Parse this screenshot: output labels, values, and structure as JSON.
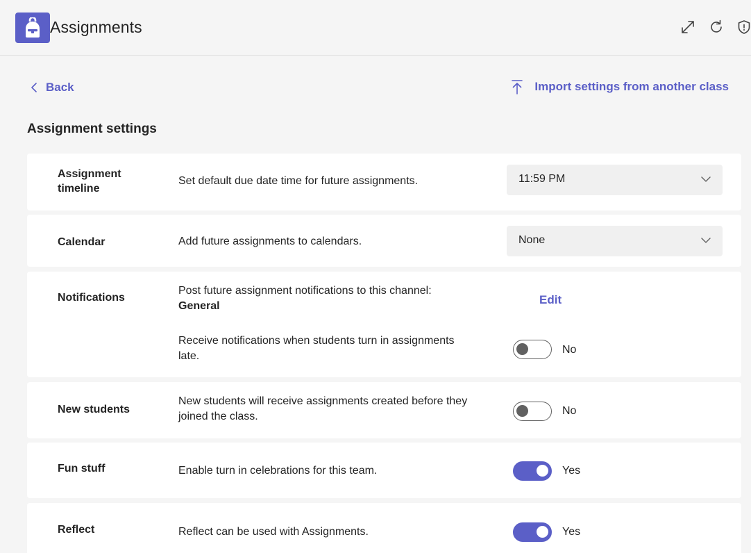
{
  "app": {
    "title": "Assignments",
    "icons": [
      "backpack-icon",
      "expand-icon",
      "refresh-icon",
      "shield-icon"
    ],
    "accent_color": "#5b5fc7"
  },
  "nav": {
    "back_label": "Back",
    "import_label": "Import settings from another class"
  },
  "section_title": "Assignment settings",
  "settings": {
    "timeline": {
      "label": "Assignment timeline",
      "description": "Set default due date time for future assignments.",
      "value": "11:59 PM"
    },
    "calendar": {
      "label": "Calendar",
      "description": "Add future assignments to calendars.",
      "value": "None"
    },
    "notifications": {
      "label": "Notifications",
      "channel_description": "Post future assignment notifications to this channel:",
      "channel_name": "General",
      "edit_label": "Edit",
      "late_description": "Receive notifications when students turn in assignments late.",
      "late_state": "No",
      "late_on": false
    },
    "new_students": {
      "label": "New students",
      "description": "New students will receive assignments created before they joined the class.",
      "state": "No",
      "on": false
    },
    "fun_stuff": {
      "label": "Fun stuff",
      "description": "Enable turn in celebrations for this team.",
      "state": "Yes",
      "on": true
    },
    "reflect": {
      "label": "Reflect",
      "description": "Reflect can be used with Assignments.",
      "state": "Yes",
      "on": true
    }
  }
}
